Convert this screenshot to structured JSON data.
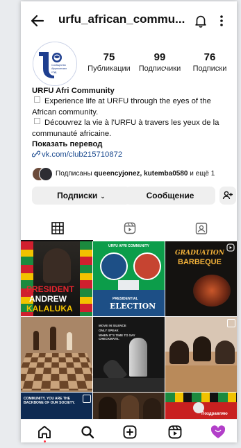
{
  "header": {
    "username": "urfu_african_commu...",
    "back_icon": "arrow-left-icon",
    "bell_icon": "bell-icon",
    "more_icon": "more-vertical-icon"
  },
  "stats": [
    {
      "value": "75",
      "label": "Публикации"
    },
    {
      "value": "99",
      "label": "Подписчики"
    },
    {
      "value": "76",
      "label": "Подписки"
    }
  ],
  "bio": {
    "name": "URFU Afri Community",
    "line1": "Experience life at URFU through the eyes of the African community.",
    "line2": "Découvrez la vie à l'URFU à travers les yeux de la communauté africaine.",
    "translate": "Показать перевод",
    "link": "vk.com/club215710872"
  },
  "followers": {
    "prefix": "Подписаны ",
    "names": "queencyjonez, kutemba0580",
    "suffix": " и ещё 1"
  },
  "actions": {
    "subscriptions": "Подписки",
    "message": "Сообщение",
    "add_user_icon": "add-person-icon"
  },
  "tabs": [
    "grid-icon",
    "reels-icon",
    "tagged-icon"
  ],
  "posts": [
    {
      "caption": "PRESIDENT",
      "caption2": "ANDREW",
      "caption3": "KALALUKA"
    },
    {
      "caption": "URFU AFRI COMMUNITY",
      "caption2": "PRESIDENTIAL",
      "caption3": "ELECTION"
    },
    {
      "caption": "GRADUATION",
      "caption2": "BARBEQUE"
    },
    {
      "caption": ""
    },
    {
      "caption": "MOVE IN SILENCE",
      "caption2": "ONLY SPEAK",
      "caption3": "WHEN IT'S TIME TO SAY CHECKMATE."
    },
    {
      "caption": ""
    },
    {
      "caption": "COMMUNITY, YOU ARE THE BACKBONE OF OUR SOCIETY."
    },
    {
      "caption": ""
    },
    {
      "caption": "Поздравляю"
    }
  ],
  "bottom_nav": [
    "home-icon",
    "search-icon",
    "create-icon",
    "reels-icon",
    "profile-icon"
  ]
}
